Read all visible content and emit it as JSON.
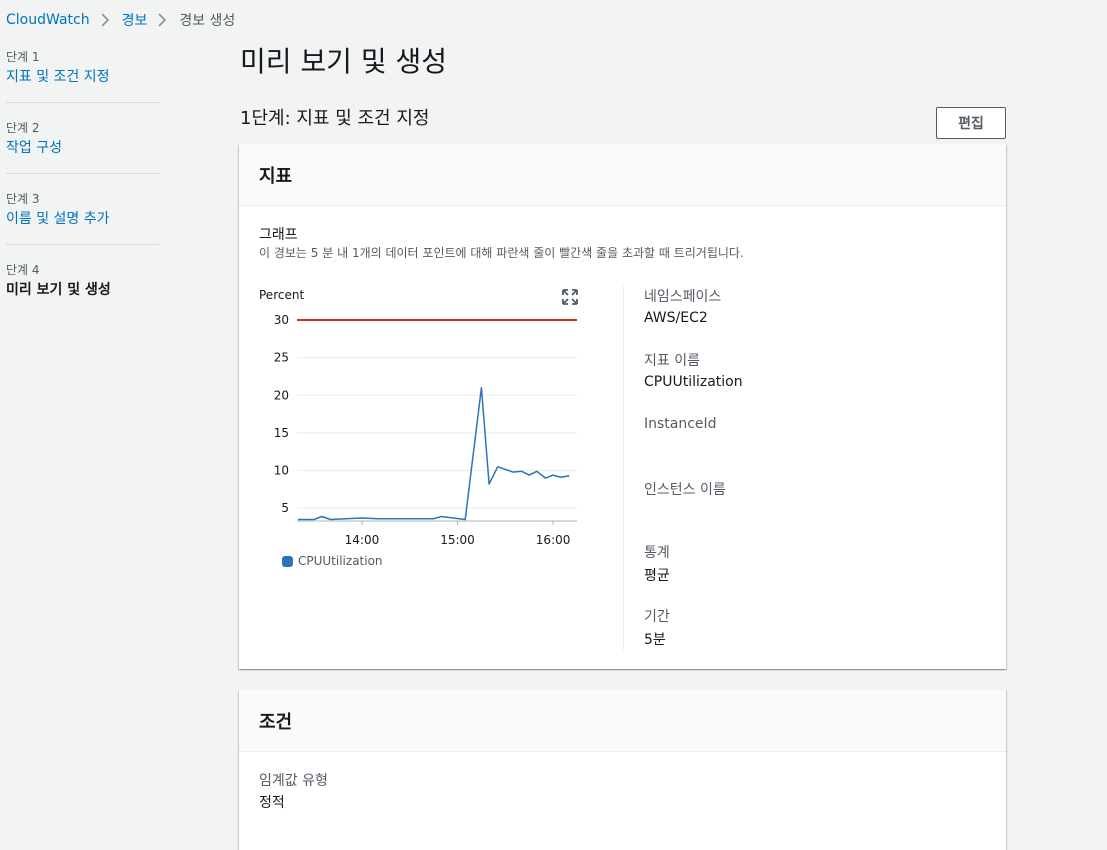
{
  "breadcrumb": {
    "items": [
      "CloudWatch",
      "경보",
      "경보 생성"
    ]
  },
  "steps": [
    {
      "number": "단계 1",
      "label": "지표 및 조건 지정"
    },
    {
      "number": "단계 2",
      "label": "작업 구성"
    },
    {
      "number": "단계 3",
      "label": "이름 및 설명 추가"
    },
    {
      "number": "단계 4",
      "label": "미리 보기 및 생성"
    }
  ],
  "page_title": "미리 보기 및 생성",
  "section": {
    "title": "1단계: 지표 및 조건 지정",
    "edit_label": "편집"
  },
  "metrics_card": {
    "title": "지표",
    "graph_label": "그래프",
    "graph_description": "이 경보는 5 분 내 1개의 데이터 포인트에 대해 파란색 줄이 빨간색 줄을 초과할 때 트리거됩니다.",
    "details": {
      "namespace_label": "네임스페이스",
      "namespace_value": "AWS/EC2",
      "metric_name_label": "지표 이름",
      "metric_name_value": "CPUUtilization",
      "instance_id_label": "InstanceId",
      "instance_name_label": "인스턴스 이름",
      "statistic_label": "통계",
      "statistic_value": "평균",
      "period_label": "기간",
      "period_value": "5분"
    }
  },
  "conditions_card": {
    "title": "조건",
    "threshold_type_label": "임계값 유형",
    "threshold_type_value": "정적"
  },
  "colors": {
    "link": "#0073bb",
    "series": "#2e73b8",
    "threshold": "#d13212"
  },
  "chart_data": {
    "type": "line",
    "ylabel": "Percent",
    "ylim": [
      3.3,
      30
    ],
    "yticks": [
      5,
      10,
      15,
      20,
      25,
      30
    ],
    "x_tick_labels": [
      "14:00",
      "15:00",
      "16:00"
    ],
    "x_tick_values": [
      14.0,
      15.0,
      16.0
    ],
    "xlim": [
      13.32,
      16.25
    ],
    "grid": true,
    "legend_position": "bottom-left",
    "threshold": {
      "value": 30,
      "color": "#d13212"
    },
    "series": [
      {
        "name": "CPUUtilization",
        "color": "#2e73b8",
        "x": [
          13.33,
          13.5,
          13.58,
          13.67,
          13.83,
          14.0,
          14.17,
          14.33,
          14.5,
          14.75,
          14.83,
          15.08,
          15.25,
          15.33,
          15.42,
          15.58,
          15.67,
          15.75,
          15.83,
          15.92,
          16.0,
          16.08,
          16.17
        ],
        "values": [
          3.5,
          3.5,
          3.9,
          3.5,
          3.6,
          3.7,
          3.6,
          3.6,
          3.6,
          3.6,
          3.9,
          3.5,
          21.0,
          8.2,
          10.5,
          9.8,
          9.9,
          9.4,
          9.9,
          9.0,
          9.4,
          9.1,
          9.3
        ]
      }
    ]
  }
}
